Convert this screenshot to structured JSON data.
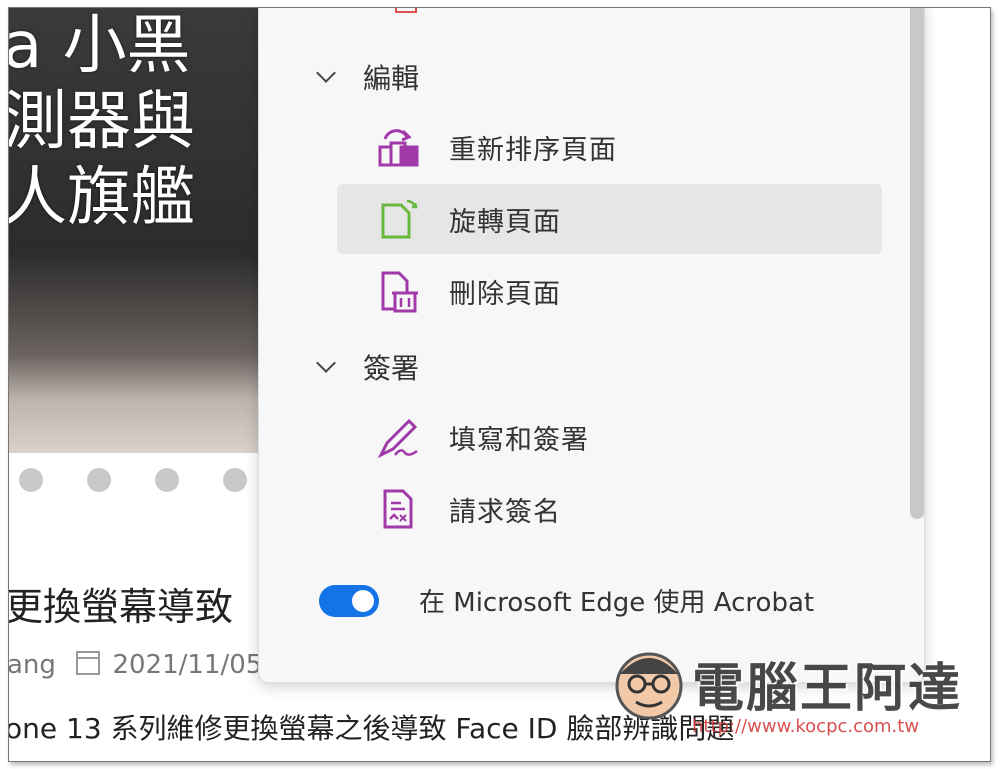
{
  "background_page": {
    "hero_title_lines": [
      "a 小黑",
      "測器與",
      "人旗艦"
    ],
    "article_title": "更換螢幕導致",
    "meta_author": "ang",
    "meta_date": "2021/11/05",
    "body_text": "one 13 系列維修更換螢幕之後導致 Face ID 臉部辨識問題"
  },
  "acrobat_panel": {
    "sections": [
      {
        "label": "編輯",
        "items": [
          {
            "label": "重新排序頁面",
            "icon": "reorder-pages-icon"
          },
          {
            "label": "旋轉頁面",
            "icon": "rotate-pages-icon",
            "selected": true
          },
          {
            "label": "刪除頁面",
            "icon": "delete-pages-icon"
          }
        ]
      },
      {
        "label": "簽署",
        "items": [
          {
            "label": "填寫和簽署",
            "icon": "fill-and-sign-icon"
          },
          {
            "label": "請求簽名",
            "icon": "request-signature-icon"
          }
        ]
      }
    ],
    "toggle": {
      "label": "在 Microsoft Edge 使用 Acrobat",
      "on": true
    }
  },
  "watermark": {
    "text": "電腦王阿達",
    "url": "http://www.kocpc.com.tw"
  },
  "colors": {
    "accent_blue": "#1473e6",
    "icon_purple": "#a13aa8",
    "icon_green": "#68b83e",
    "selected_bg": "#e6e6e6"
  }
}
